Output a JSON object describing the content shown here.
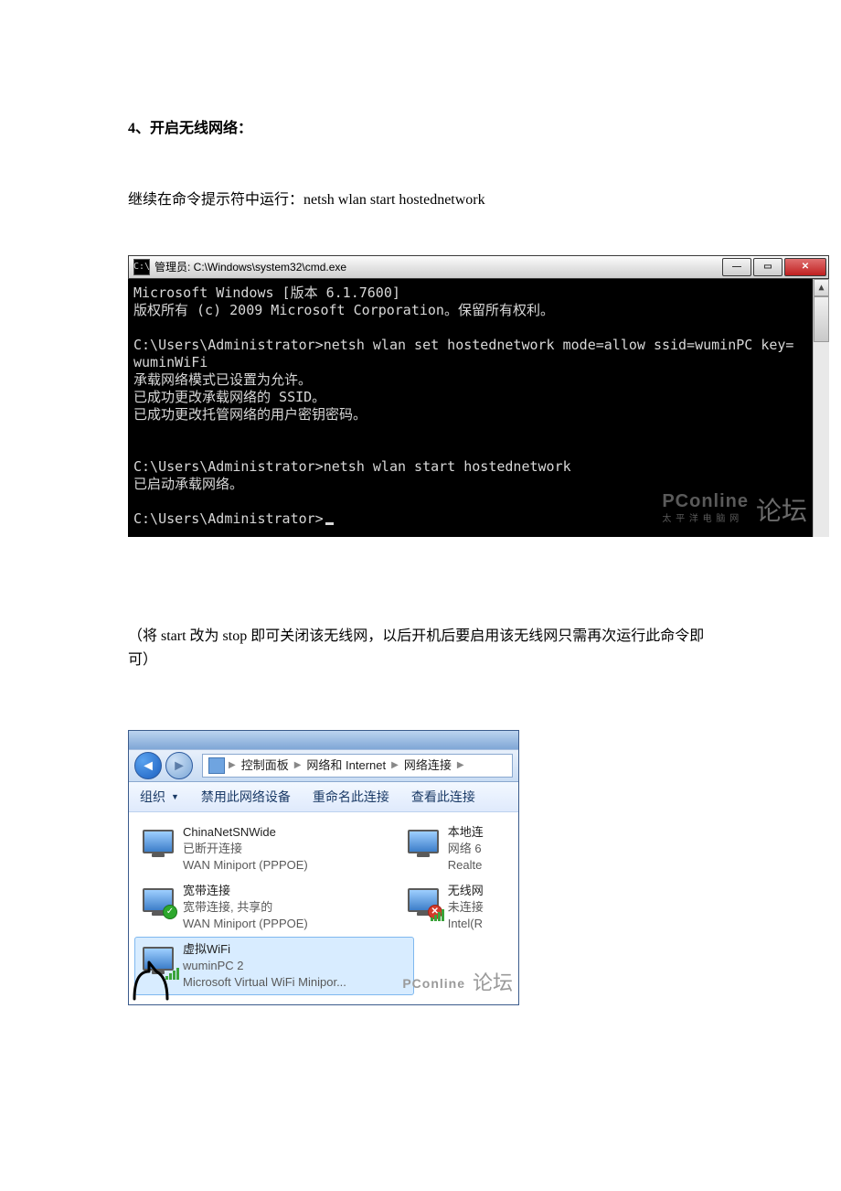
{
  "doc": {
    "heading": "4、开启无线网络：",
    "para1": "继续在命令提示符中运行：netsh   wlan   start   hostednetwork",
    "para2": "（将 start 改为 stop 即可关闭该无线网，以后开机后要启用该无线网只需再次运行此命令即可）"
  },
  "cmd": {
    "title": "管理员: C:\\Windows\\system32\\cmd.exe",
    "lines": {
      "l1": "Microsoft Windows [版本 6.1.7600]",
      "l2": "版权所有 (c) 2009 Microsoft Corporation。保留所有权利。",
      "l3": "C:\\Users\\Administrator>netsh wlan set hostednetwork mode=allow ssid=wuminPC key=",
      "l4": "wuminWiFi",
      "l5": "承载网络模式已设置为允许。",
      "l6": "已成功更改承载网络的 SSID。",
      "l7": "已成功更改托管网络的用户密钥密码。",
      "l8": "C:\\Users\\Administrator>netsh wlan start hostednetwork",
      "l9": "已启动承载网络。",
      "l10": "C:\\Users\\Administrator>"
    },
    "watermark_pc": "PConline",
    "watermark_sub": "太 平 洋 电 脑 网",
    "watermark_bbs": "论坛"
  },
  "explorer": {
    "breadcrumbs": {
      "b1": "控制面板",
      "b2": "网络和 Internet",
      "b3": "网络连接"
    },
    "toolbar": {
      "org": "组织",
      "t1": "禁用此网络设备",
      "t2": "重命名此连接",
      "t3": "查看此连接"
    },
    "conn1": {
      "name": "ChinaNetSNWide",
      "status": "已断开连接",
      "dev": "WAN Miniport (PPPOE)"
    },
    "conn2": {
      "name": "宽带连接",
      "status": "宽带连接, 共享的",
      "dev": "WAN Miniport (PPPOE)"
    },
    "conn3": {
      "name": "虚拟WiFi",
      "status": "wuminPC  2",
      "dev": "Microsoft Virtual WiFi Minipor..."
    },
    "conn4": {
      "name": "本地连",
      "status": "网络  6",
      "dev": "Realte"
    },
    "conn5": {
      "name": "无线网",
      "status": "未连接",
      "dev": "Intel(R"
    },
    "watermark_pc": "PConline",
    "watermark_bbs": "论坛"
  }
}
